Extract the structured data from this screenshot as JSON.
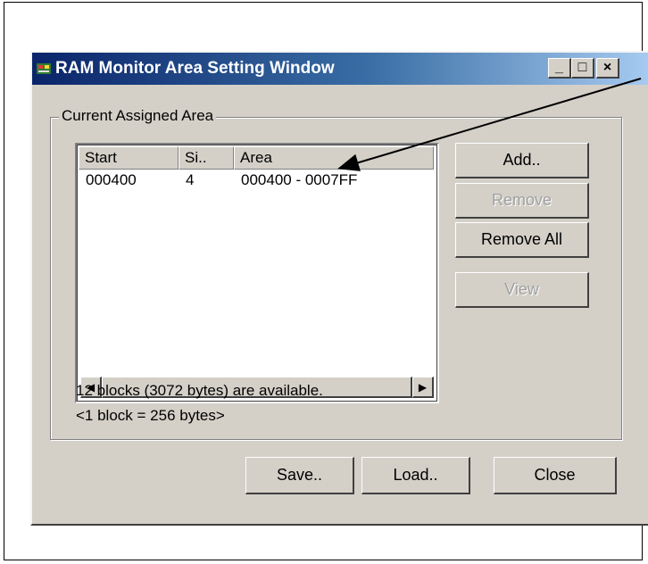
{
  "window": {
    "title": "RAM Monitor Area Setting Window",
    "minimize_glyph": "_",
    "maximize_glyph": "□",
    "close_glyph": "×"
  },
  "group": {
    "label": "Current Assigned Area"
  },
  "list": {
    "columns": [
      "Start",
      "Si..",
      "Area"
    ],
    "rows": [
      {
        "start": "000400",
        "size": "4",
        "area": "000400 - 0007FF"
      }
    ]
  },
  "side_buttons": {
    "add": "Add..",
    "remove": "Remove",
    "remove_all": "Remove All",
    "view": "View"
  },
  "info": {
    "available": "12 blocks (3072 bytes) are available.",
    "block_size": "<1 block = 256 bytes>"
  },
  "bottom_buttons": {
    "save": "Save..",
    "load": "Load..",
    "close": "Close"
  },
  "colors": {
    "titlebar_start": "#0a246a",
    "titlebar_end": "#a6caf0",
    "face": "#d4d0c8",
    "disabled_text": "#a0a0a0"
  }
}
